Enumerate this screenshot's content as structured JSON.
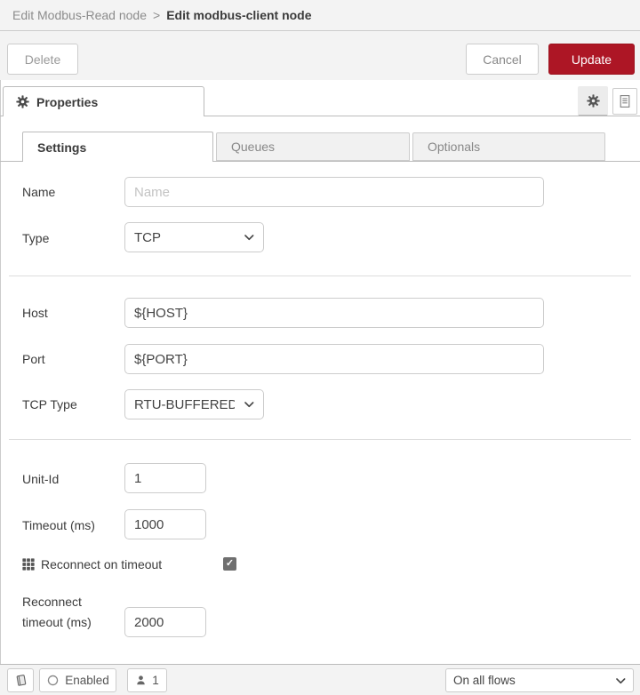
{
  "breadcrumb": {
    "parent": "Edit Modbus-Read node",
    "separator": ">",
    "current": "Edit modbus-client node"
  },
  "toolbar": {
    "delete": "Delete",
    "cancel": "Cancel",
    "update": "Update"
  },
  "panel": {
    "properties_tab": "Properties"
  },
  "tabs": {
    "settings": "Settings",
    "queues": "Queues",
    "optionals": "Optionals"
  },
  "form": {
    "name": {
      "label": "Name",
      "placeholder": "Name",
      "value": ""
    },
    "type": {
      "label": "Type",
      "value": "TCP"
    },
    "host": {
      "label": "Host",
      "value": "${HOST}"
    },
    "port": {
      "label": "Port",
      "value": "${PORT}"
    },
    "tcp_type": {
      "label": "TCP Type",
      "value": "RTU-BUFFERED"
    },
    "unit_id": {
      "label": "Unit-Id",
      "value": "1"
    },
    "timeout": {
      "label": "Timeout (ms)",
      "value": "1000"
    },
    "reconnect_on_timeout": {
      "label": "Reconnect on timeout",
      "checkmark": "✓"
    },
    "reconnect_timeout": {
      "label": "Reconnect timeout (ms)",
      "value": "2000"
    }
  },
  "footer": {
    "enabled": "Enabled",
    "user_count": "1",
    "scope": "On all flows"
  },
  "colors": {
    "accent_red": "#AD1625",
    "bar_bg": "#f3f3f3",
    "border": "#cccccc"
  }
}
